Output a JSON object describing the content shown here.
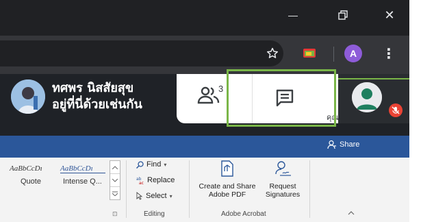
{
  "window_controls": {
    "minimize_glyph": "—",
    "restore_glyph": "❐",
    "close_glyph": "✕"
  },
  "toolbar": {
    "bookmark_icon": "star-icon",
    "profile_initial": "A",
    "menu_glyph": "⋮"
  },
  "meet": {
    "presenter_name_line1": "ทศพร นิสสัยสุข",
    "presenter_name_line2": "อยู่ที่นี่ด้วยเช่นกัน",
    "people_count": "3",
    "self_label": "คุณ",
    "highlight_color": "#7ab648"
  },
  "word": {
    "share_label": "Share",
    "styles": [
      {
        "preview": "AaBbCcDı",
        "name": "Quote"
      },
      {
        "preview": "AaBbCcDı",
        "name": "Intense Q..."
      }
    ],
    "editing": {
      "find": "Find",
      "replace": "Replace",
      "select": "Select",
      "group_label": "Editing"
    },
    "acrobat": {
      "create_share_line1": "Create and Share",
      "create_share_line2": "Adobe PDF",
      "request_line1": "Request",
      "request_line2": "Signatures",
      "group_label": "Adobe Acrobat"
    },
    "brand_color": "#2b579a"
  }
}
